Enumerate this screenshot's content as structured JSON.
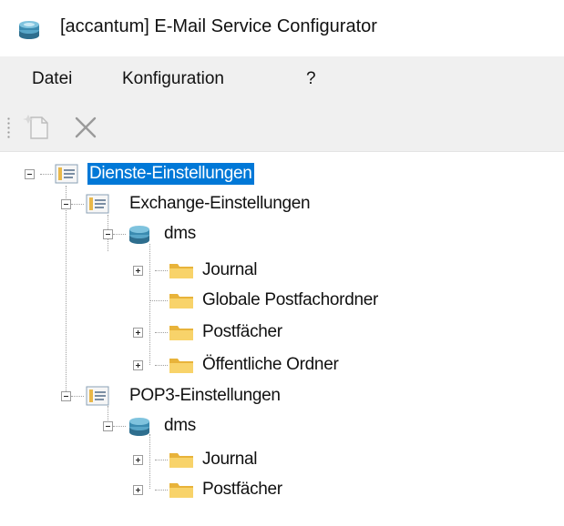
{
  "window": {
    "title": "[accantum] E-Mail Service Configurator",
    "icon": "server-stack-icon"
  },
  "menu": {
    "items": [
      "Datei",
      "Konfiguration",
      "?"
    ]
  },
  "toolbar": {
    "buttons": [
      {
        "icon": "new-document-icon"
      },
      {
        "icon": "close-x-icon"
      }
    ]
  },
  "tree": {
    "root": "Dienste-Einstellungen",
    "exchange": {
      "label": "Exchange-Einstellungen",
      "server": "dms",
      "folders": [
        "Journal",
        "Globale Postfachordner",
        "Postfächer",
        "Öffentliche Ordner"
      ]
    },
    "pop3": {
      "label": "POP3-Einstellungen",
      "server": "dms",
      "folders": [
        "Journal",
        "Postfächer"
      ]
    }
  },
  "colors": {
    "selection": "#0078d7",
    "menubar": "#f0f0f0",
    "folder": "#f5c342"
  }
}
